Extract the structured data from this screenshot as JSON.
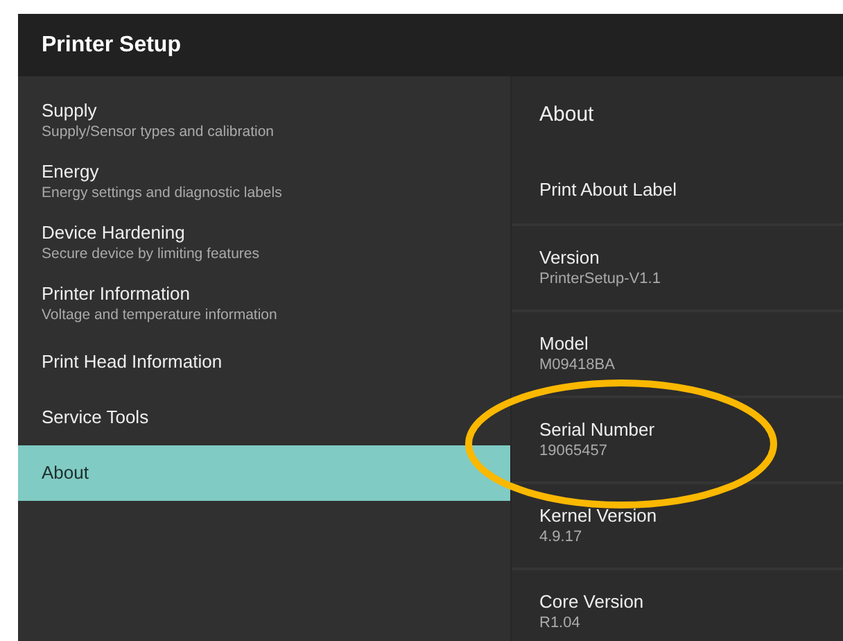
{
  "app_bar": {
    "title": "Printer Setup"
  },
  "nav_items": [
    {
      "title": "Supply",
      "subtitle": "Supply/Sensor types and calibration",
      "selected": false
    },
    {
      "title": "Energy",
      "subtitle": "Energy settings and diagnostic labels",
      "selected": false
    },
    {
      "title": "Device Hardening",
      "subtitle": "Secure device by limiting features",
      "selected": false
    },
    {
      "title": "Printer Information",
      "subtitle": "Voltage and temperature information",
      "selected": false
    },
    {
      "title": "Print Head Information",
      "selected": false
    },
    {
      "title": "Service Tools",
      "selected": false
    },
    {
      "title": "About",
      "selected": true
    }
  ],
  "detail": {
    "section_title": "About",
    "items": [
      {
        "title": "Print About Label"
      },
      {
        "title": "Version",
        "value": "PrinterSetup-V1.1"
      },
      {
        "title": "Model",
        "value": "M09418BA"
      },
      {
        "title": "Serial Number",
        "value": "19065457"
      },
      {
        "title": "Kernel Version",
        "value": "4.9.17"
      },
      {
        "title": "Core Version",
        "value": "R1.04"
      }
    ]
  }
}
